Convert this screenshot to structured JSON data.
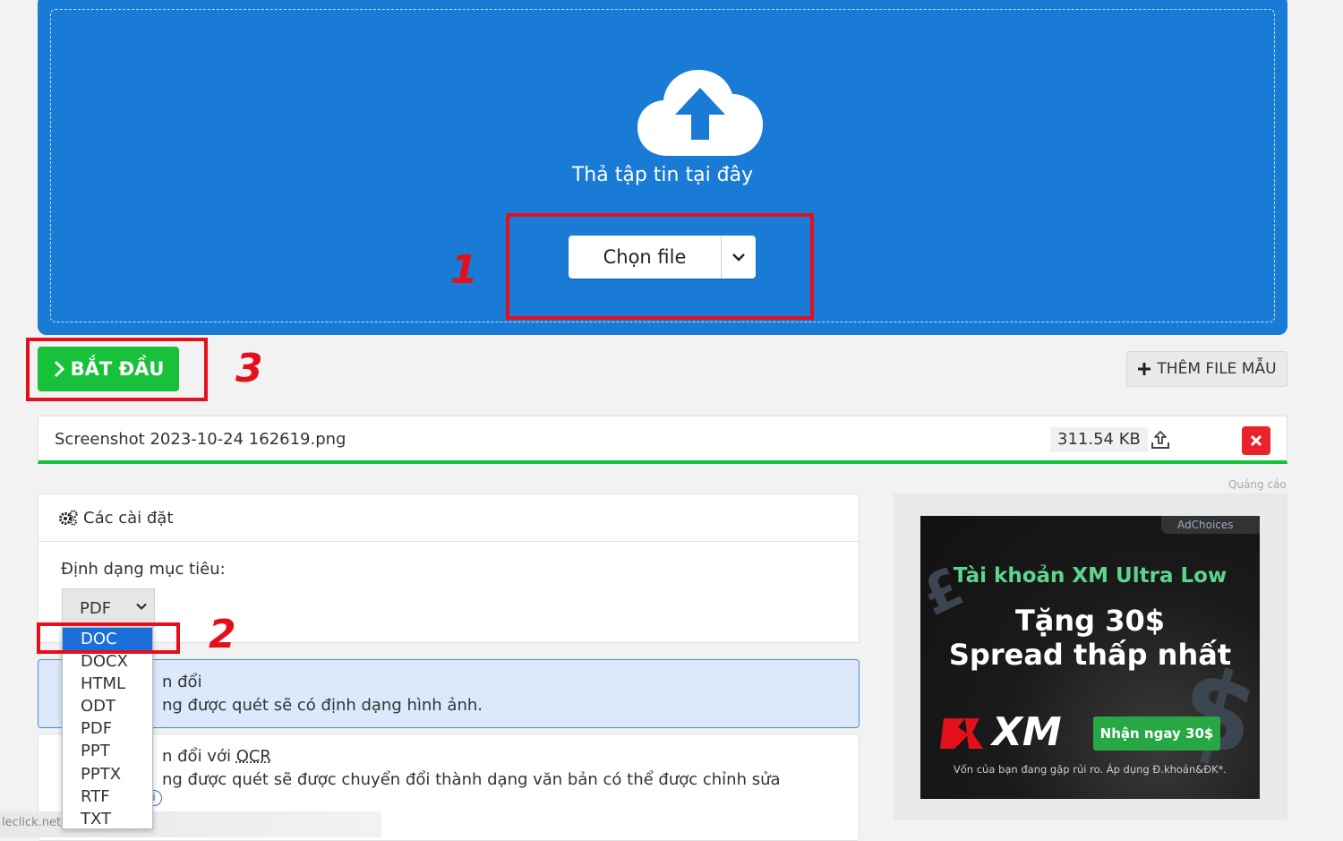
{
  "upload": {
    "drop_text": "Thả tập tin tại đây",
    "choose_label": "Chọn file"
  },
  "actions": {
    "start_label": "BẮT ĐẦU",
    "add_sample_label": "THÊM FILE MẪU"
  },
  "file": {
    "name": "Screenshot 2023-10-24 162619.png",
    "size": "311.54 KB"
  },
  "settings": {
    "title": "Các cài đặt",
    "target_label": "Định dạng mục tiêu:",
    "selected_format": "PDF",
    "options": [
      "DOC",
      "DOCX",
      "HTML",
      "ODT",
      "PDF",
      "PPT",
      "PPTX",
      "RTF",
      "TXT"
    ],
    "highlighted_option": "DOC"
  },
  "convert_options": {
    "option1_title": "n đổi",
    "option1_desc": "ng được quét sẽ có định dạng hình ảnh.",
    "option2_title_prefix": "n đổi với ",
    "option2_title_ocr": "OCR",
    "option2_desc": "ng được quét sẽ được chuyển đổi thành dạng văn bản có thể được chỉnh sửa"
  },
  "annotations": {
    "n1": "1",
    "n2": "2",
    "n3": "3"
  },
  "status_url": "leclick.net",
  "ad": {
    "label": "Quảng cáo",
    "choices": "AdChoices",
    "line1": "Tài khoản XM Ultra Low",
    "line2": "Tặng 30$",
    "line3": "Spread thấp nhất",
    "logo_text": "XM",
    "cta": "Nhận ngay 30$",
    "disclaimer": "Vốn của bạn đang gặp rủi ro. Áp dụng Đ.khoản&ĐK*."
  },
  "colors": {
    "accent_blue": "#1a7bd6",
    "start_green": "#17c23a",
    "annotation_red": "#e3101b",
    "delete_red": "#e8232a"
  }
}
